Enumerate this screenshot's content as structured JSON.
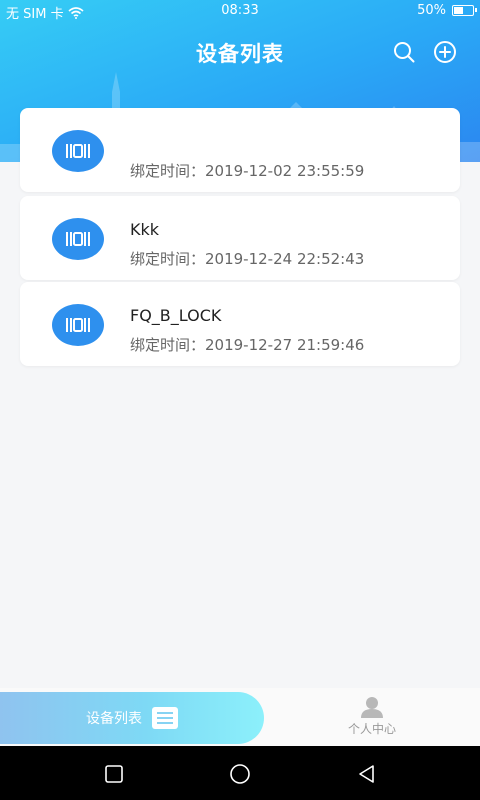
{
  "status": {
    "carrier": "无 SIM 卡",
    "time": "08:33",
    "battery": "50%",
    "battery_level": 0.5
  },
  "header": {
    "title": "设备列表",
    "icons": [
      "search-icon",
      "add-circle-icon"
    ]
  },
  "devices": [
    {
      "name": "",
      "bind_time": "绑定时间：2019-12-02 23:55:59",
      "icon": "lock-device-icon"
    },
    {
      "name": "Kkk",
      "bind_time": "绑定时间：2019-12-24 22:52:43",
      "icon": "lock-device-icon"
    },
    {
      "name": "FQ_B_LOCK",
      "bind_time": "绑定时间：2019-12-27 21:59:46",
      "icon": "lock-device-icon"
    }
  ],
  "tabs": {
    "device_list": {
      "label": "设备列表",
      "icon": "list-icon",
      "active": true
    },
    "profile": {
      "label": "个人中心",
      "icon": "person-icon",
      "active": false
    }
  },
  "navbar": {
    "icons": [
      "recent-apps-icon",
      "home-icon",
      "back-icon"
    ]
  },
  "colors": {
    "header_start": "#36cdf5",
    "header_end": "#2b86f0",
    "device_icon_bg": "#2e90ee",
    "tab_active_start": "#8fc3ef",
    "tab_active_end": "#8cf0fb"
  }
}
